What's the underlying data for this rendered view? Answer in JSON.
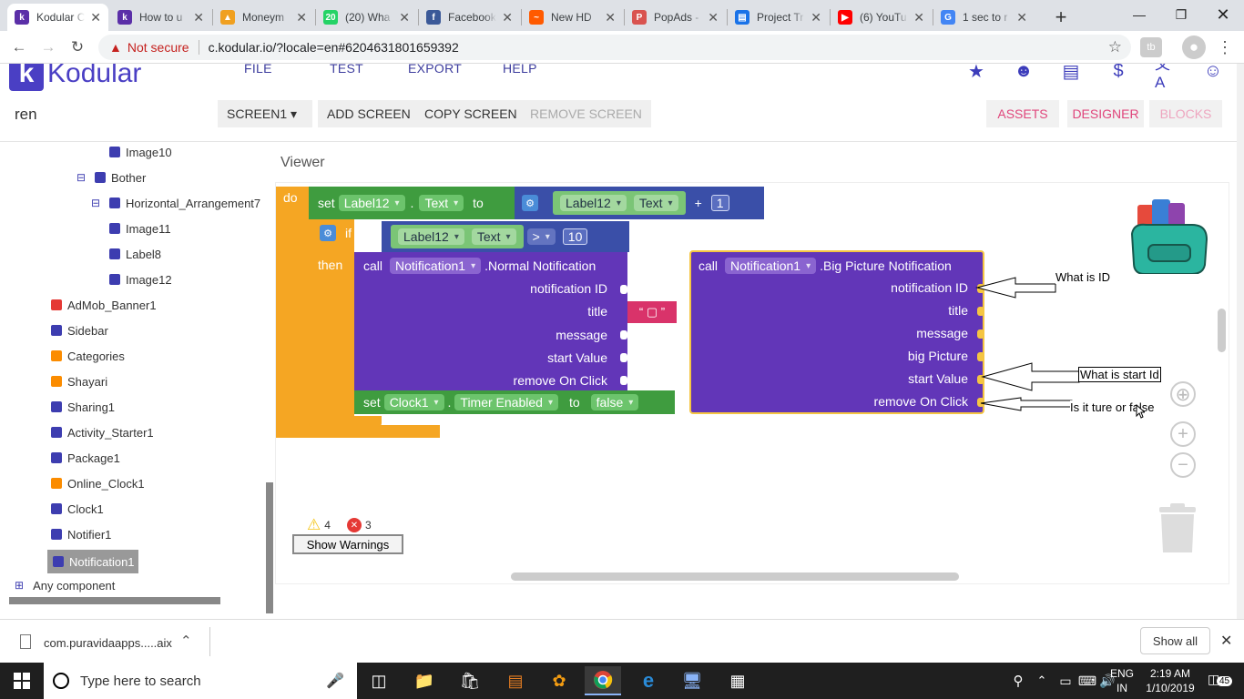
{
  "browser": {
    "tabs": [
      {
        "title": "Kodular C",
        "icon_color": "#5b2fa8",
        "icon_glyph": "k",
        "active": true
      },
      {
        "title": "How to u",
        "icon_color": "#5b2fa8",
        "icon_glyph": "k"
      },
      {
        "title": "Moneym",
        "icon_color": "#f0a020",
        "icon_glyph": "▲"
      },
      {
        "title": "(20) Wha",
        "icon_color": "#25d366",
        "icon_glyph": "20"
      },
      {
        "title": "Facebook",
        "icon_color": "#3b5998",
        "icon_glyph": "f"
      },
      {
        "title": "New HD",
        "icon_color": "#ff5a00",
        "icon_glyph": "~"
      },
      {
        "title": "PopAds -",
        "icon_color": "#d9534f",
        "icon_glyph": "P"
      },
      {
        "title": "Project Tr",
        "icon_color": "#1a73e8",
        "icon_glyph": "▤"
      },
      {
        "title": "(6) YouTu",
        "icon_color": "#ff0000",
        "icon_glyph": "▶"
      },
      {
        "title": "1 sec to r",
        "icon_color": "#4285f4",
        "icon_glyph": "G"
      }
    ],
    "new_tab": "+",
    "security": "Not secure",
    "url": "c.kodular.io/?locale=en#6204631801659392"
  },
  "app": {
    "logo_text": "Kodular",
    "project_name": "ren",
    "menus": [
      "FILE",
      "TEST",
      "EXPORT",
      "HELP"
    ],
    "screen_select": "SCREEN1 ▾",
    "add_screen": "ADD SCREEN",
    "copy_screen": "COPY SCREEN",
    "remove_screen": "REMOVE SCREEN",
    "assets": "ASSETS",
    "designer": "DESIGNER",
    "blocks": "BLOCKS"
  },
  "tree": [
    {
      "label": "Image10",
      "icon": "image-icon",
      "color": "#3d3db0"
    },
    {
      "label": "Bother",
      "icon": "screen-icon",
      "color": "#3d3db0",
      "collapse": "⊟"
    },
    {
      "label": "Horizontal_Arrangement7",
      "icon": "arrangement-icon",
      "color": "#3d3db0",
      "collapse": "⊟"
    },
    {
      "label": "Image11",
      "icon": "image-icon",
      "color": "#3d3db0"
    },
    {
      "label": "Label8",
      "icon": "label-icon",
      "color": "#3d3db0"
    },
    {
      "label": "Image12",
      "icon": "image-icon",
      "color": "#3d3db0"
    },
    {
      "label": "AdMob_Banner1",
      "icon": "admob-icon",
      "color": "#e53935"
    },
    {
      "label": "Sidebar",
      "icon": "sidebar-icon",
      "color": "#3d3db0"
    },
    {
      "label": "Categories",
      "icon": "categories-icon",
      "color": "#fb8c00"
    },
    {
      "label": "Shayari",
      "icon": "shayari-icon",
      "color": "#fb8c00"
    },
    {
      "label": "Sharing1",
      "icon": "share-icon",
      "color": "#3d3db0"
    },
    {
      "label": "Activity_Starter1",
      "icon": "activity-icon",
      "color": "#3d3db0"
    },
    {
      "label": "Package1",
      "icon": "package-icon",
      "color": "#3d3db0"
    },
    {
      "label": "Online_Clock1",
      "icon": "online-clock-icon",
      "color": "#fb8c00"
    },
    {
      "label": "Clock1",
      "icon": "clock-icon",
      "color": "#3d3db0"
    },
    {
      "label": "Notifier1",
      "icon": "notifier-icon",
      "color": "#3d3db0"
    },
    {
      "label": "Notification1",
      "icon": "notification-icon",
      "color": "#3d3db0",
      "selected": true
    }
  ],
  "any_component": "Any component",
  "viewer": {
    "title": "Viewer",
    "warnings_count": "4",
    "errors_count": "3",
    "show_warnings": "Show Warnings"
  },
  "blocks": {
    "do": "do",
    "set": "set",
    "to": "to",
    "label12": "Label12",
    "text": "Text",
    "plus": "+",
    "one": "1",
    "if": "if",
    "then": "then",
    "gt": ">",
    "ten": "10",
    "call": "call",
    "notification1": "Notification1",
    "normal_notification": ".Normal Notification",
    "big_picture_notification": ".Big Picture Notification",
    "params_normal": [
      "notification ID",
      "title",
      "message",
      "start Value",
      "remove On Click"
    ],
    "params_big": [
      "notification ID",
      "title",
      "message",
      "big Picture",
      "start Value",
      "remove On Click"
    ],
    "empty_text": "“ ▢ ”",
    "clock1": "Clock1",
    "timer_enabled": "Timer Enabled",
    "false": "false",
    "dot": "."
  },
  "annotations": {
    "what_is_id": "What is ID",
    "what_is_start_id": "What is start Id",
    "is_it_true": "Is it ture or false"
  },
  "download": {
    "file": "com.puravidaapps.....aix",
    "show_all": "Show all"
  },
  "taskbar": {
    "search_placeholder": "Type here to search",
    "lang": "ENG",
    "region": "IN",
    "time": "2:19 AM",
    "date": "1/10/2019",
    "notif_count": "45"
  }
}
